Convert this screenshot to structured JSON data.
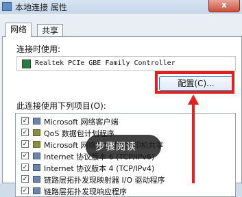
{
  "window": {
    "title": "本地连接 属性",
    "close_label": "x"
  },
  "tabs": [
    "网络",
    "共享"
  ],
  "connect_using_label": "连接时使用:",
  "adapter_name": "Realtek PCIe GBE Family Controller",
  "configure_button": "配置(C)...",
  "items_label": "此连接使用下列项目(O):",
  "items": [
    {
      "checked": "✓",
      "text": "Microsoft 网络客户端"
    },
    {
      "checked": "✓",
      "text": "QoS 数据包计划程序"
    },
    {
      "checked": "✓",
      "text": "Microsoft 网络的文件和打印机共享"
    },
    {
      "checked": "✓",
      "text": "Internet 协议版本 6 (TCP/IPv6)"
    },
    {
      "checked": "✓",
      "text": "Internet 协议版本 4 (TCP/IPv4)"
    },
    {
      "checked": "✓",
      "text": "链路层拓扑发现映射器 I/O 驱动程序"
    },
    {
      "checked": "✓",
      "text": "链路层拓扑发现响应程序"
    }
  ],
  "overlay": {
    "label": "步骤阅读"
  },
  "colors": {
    "highlight": "#e2201f",
    "overlay_bg": "#1a1a1a"
  }
}
